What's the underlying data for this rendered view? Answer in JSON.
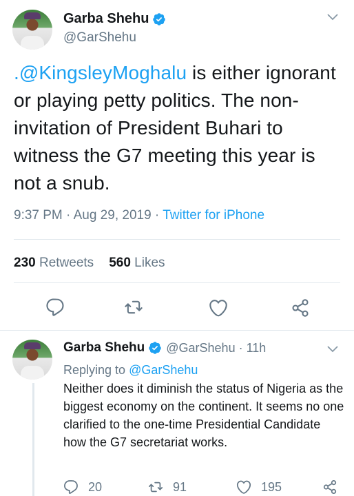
{
  "main_tweet": {
    "display_name": "Garba Shehu",
    "handle": "@GarShehu",
    "text_mention": ".@KingsleyMoghalu",
    "text_body": " is either ignorant or playing petty politics. The non-invitation of President Buhari to witness the G7 meeting this year is not a snub.",
    "time": "9:37 PM · Aug 29, 2019 · ",
    "source": "Twitter for iPhone",
    "retweets_count": "230",
    "retweets_label": "Retweets",
    "likes_count": "560",
    "likes_label": "Likes"
  },
  "reply_tweet": {
    "display_name": "Garba Shehu",
    "handle_time": "@GarShehu · 11h",
    "replying_prefix": "Replying to ",
    "replying_to": "@GarShehu",
    "text": "Neither does it diminish the status of Nigeria as the biggest economy on the continent. It seems no one clarified to the one-time Presidential Candidate how the G7 secretariat works.",
    "reply_count": "20",
    "retweet_count": "91",
    "like_count": "195"
  },
  "colors": {
    "accent": "#1da1f2",
    "secondary_text": "#657786",
    "divider": "#e1e8ed"
  },
  "icons": {
    "verified": "verified-badge-icon",
    "chevron": "chevron-down-icon",
    "reply": "reply-icon",
    "retweet": "retweet-icon",
    "like": "heart-icon",
    "share": "share-icon"
  }
}
